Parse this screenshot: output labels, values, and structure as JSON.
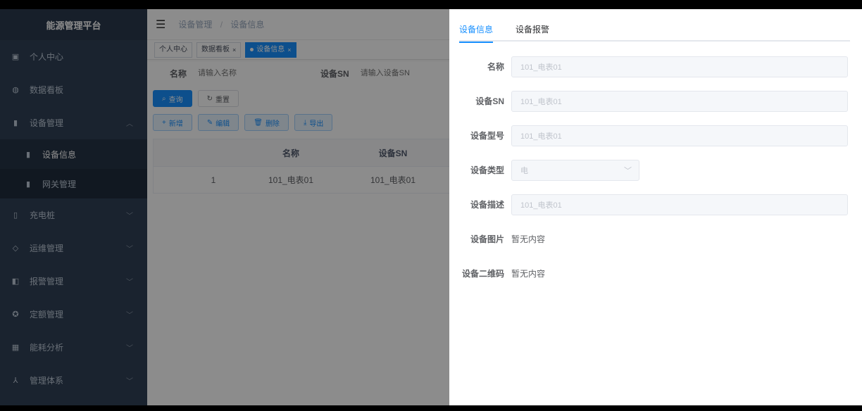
{
  "app": {
    "title": "能源管理平台"
  },
  "sidebar": {
    "items": [
      {
        "label": "个人中心",
        "icon": "user-icon",
        "glyph": "▣"
      },
      {
        "label": "数据看板",
        "icon": "dashboard-icon",
        "glyph": "◍"
      },
      {
        "label": "设备管理",
        "icon": "chart-icon",
        "glyph": "▮",
        "expanded": true,
        "children": [
          {
            "label": "设备信息",
            "active": true
          },
          {
            "label": "网关管理"
          }
        ]
      },
      {
        "label": "充电桩",
        "icon": "battery-icon",
        "glyph": "▯"
      },
      {
        "label": "运维管理",
        "icon": "tool-icon",
        "glyph": "◇"
      },
      {
        "label": "报警管理",
        "icon": "alarm-icon",
        "glyph": "◧"
      },
      {
        "label": "定额管理",
        "icon": "target-icon",
        "glyph": "✪"
      },
      {
        "label": "能耗分析",
        "icon": "grid-icon",
        "glyph": "▦"
      },
      {
        "label": "管理体系",
        "icon": "tree-icon",
        "glyph": "⅄"
      }
    ]
  },
  "navbar": {
    "breadcrumb": [
      "设备管理",
      "设备信息"
    ],
    "separator": "/"
  },
  "tags": [
    {
      "label": "个人中心",
      "active": false,
      "closable": false
    },
    {
      "label": "数据看板",
      "active": false,
      "closable": true
    },
    {
      "label": "设备信息",
      "active": true,
      "closable": true
    }
  ],
  "search": {
    "name_label": "名称",
    "name_placeholder": "请输入名称",
    "sn_label": "设备SN",
    "sn_placeholder": "请输入设备SN",
    "query_label": "查询",
    "reset_label": "重置"
  },
  "toolbar": {
    "add_label": "新增",
    "edit_label": "编辑",
    "delete_label": "删除",
    "export_label": "导出"
  },
  "table": {
    "columns": [
      "",
      "",
      "名称",
      "设备SN"
    ],
    "rows": [
      [
        "",
        "1",
        "101_电表01",
        "101_电表01"
      ]
    ]
  },
  "drawer": {
    "tabs": [
      {
        "label": "设备信息",
        "active": true
      },
      {
        "label": "设备报警",
        "active": false
      }
    ],
    "fields": {
      "name": {
        "label": "名称",
        "value": "101_电表01"
      },
      "sn": {
        "label": "设备SN",
        "value": "101_电表01"
      },
      "model": {
        "label": "设备型号",
        "value": "101_电表01"
      },
      "type": {
        "label": "设备类型",
        "value": "电"
      },
      "desc": {
        "label": "设备描述",
        "value": "101_电表01"
      },
      "image": {
        "label": "设备图片",
        "value": "暂无内容"
      },
      "qrcode": {
        "label": "设备二维码",
        "value": "暂无内容"
      }
    }
  },
  "colors": {
    "sidebar": "#304156",
    "accent": "#1890ff"
  }
}
